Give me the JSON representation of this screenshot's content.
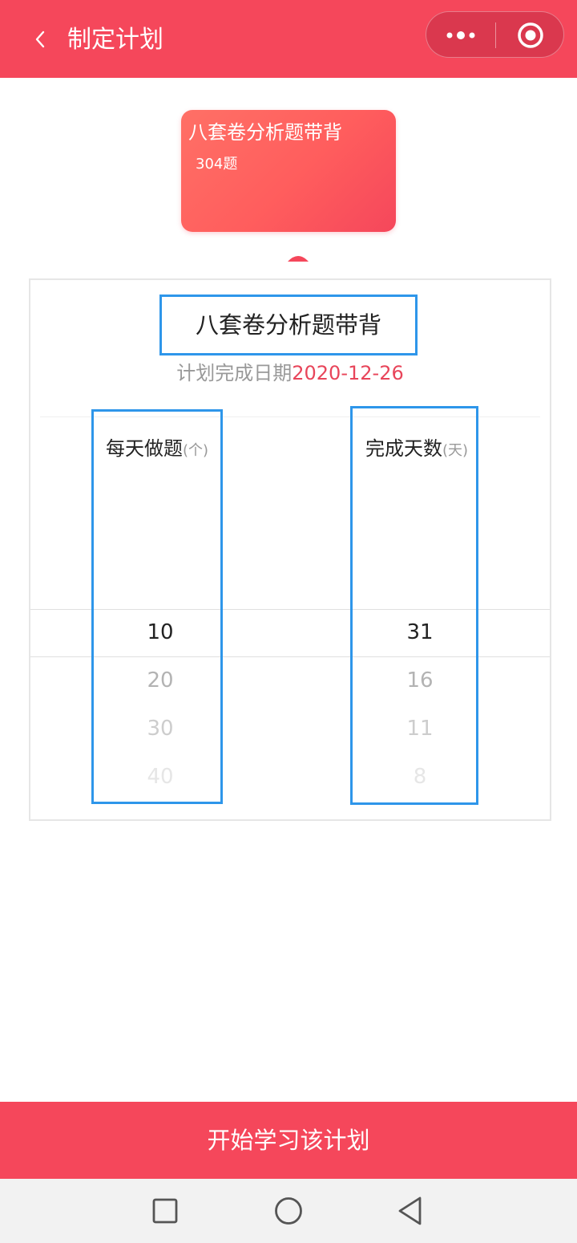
{
  "nav": {
    "title": "制定计划",
    "back_icon": "chevron-left-icon",
    "more_icon": "more-dots-icon",
    "close_icon": "target-circle-icon"
  },
  "book": {
    "title": "八套卷分析题带背",
    "count": "304题"
  },
  "plan": {
    "title": "八套卷分析题带背",
    "finish_label": "计划完成日期",
    "finish_date": "2020-12-26",
    "left_column": {
      "label": "每天做题",
      "unit": "(个)",
      "values": [
        "10",
        "20",
        "30",
        "40"
      ],
      "selected": "10"
    },
    "right_column": {
      "label": "完成天数",
      "unit": "(天)",
      "values": [
        "31",
        "16",
        "11",
        "8"
      ],
      "selected": "31"
    }
  },
  "actions": {
    "start_label": "开始学习该计划"
  },
  "colors": {
    "brand": "#f5475b",
    "date": "#e8455a",
    "highlight_border": "#2e96ea"
  },
  "system_nav": {
    "recent_icon": "square-icon",
    "home_icon": "circle-icon",
    "back_icon": "triangle-back-icon"
  }
}
